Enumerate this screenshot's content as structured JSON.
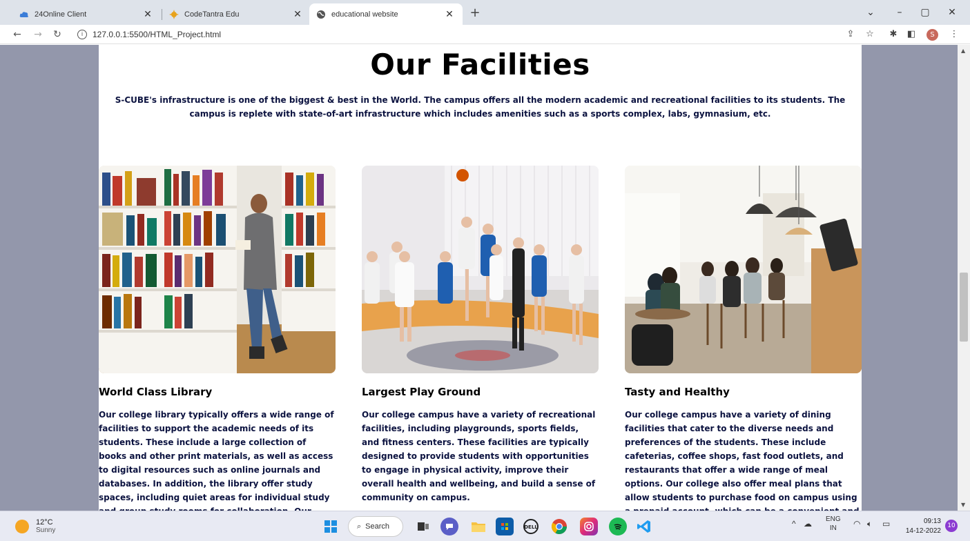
{
  "browser": {
    "tabs": [
      {
        "title": "24Online Client",
        "icon": "cloud-icon"
      },
      {
        "title": "CodeTantra Edu",
        "icon": "codetantra-icon"
      },
      {
        "title": "educational website",
        "icon": "globe-icon",
        "active": true
      }
    ],
    "url": "127.0.0.1:5500/HTML_Project.html",
    "profile_initial": "S"
  },
  "page": {
    "title": "Our Facilities",
    "intro": "S-CUBE's infrastructure is one of the biggest & best in the World. The campus offers all the modern academic and recreational facilities to its students. The campus is replete with state-of-art infrastructure which includes amenities such as a sports complex, labs, gymnasium, etc.",
    "cards": [
      {
        "title": "World Class Library",
        "text": "Our college library typically offers a wide range of facilities to support the academic needs of its students. These include a large collection of books and other print materials, as well as access to digital resources such as online journals and databases. In addition, the library offer study spaces, including quiet areas for individual study and group study rooms for collaboration. Our"
      },
      {
        "title": "Largest Play Ground",
        "text": "Our college campus have a variety of recreational facilities, including playgrounds, sports fields, and fitness centers. These facilities are typically designed to provide students with opportunities to engage in physical activity, improve their overall health and wellbeing, and build a sense of community on campus."
      },
      {
        "title": "Tasty and Healthy",
        "text": "Our college campus have a variety of dining facilities that cater to the diverse needs and preferences of the students. These include cafeterias, coffee shops, fast food outlets, and restaurants that offer a wide range of meal options. Our college also offer meal plans that allow students to purchase food on campus using a prepaid account, which can be a convenient and"
      }
    ]
  },
  "taskbar": {
    "temperature": "12°C",
    "condition": "Sunny",
    "search_label": "Search",
    "language": "ENG",
    "region": "IN",
    "time": "09:13",
    "date": "14-12-2022",
    "notifications": "10"
  },
  "colors": {
    "side_background": "#9397ab",
    "text_navy": "#0c1340",
    "tabstrip": "#dee3ea"
  }
}
